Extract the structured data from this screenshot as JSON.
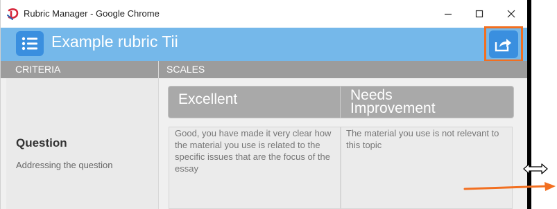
{
  "window": {
    "title": "Rubric Manager - Google Chrome",
    "controls": {
      "minimize": "—",
      "maximize": "☐",
      "close": "✕"
    }
  },
  "header": {
    "title": "Example rubric Tii",
    "menu_icon": "list-icon",
    "share_icon": "share-icon"
  },
  "columns": {
    "criteria": "CRITERIA",
    "scales": "SCALES"
  },
  "scales": [
    "Excellent",
    "Needs Improvement"
  ],
  "criterion": {
    "title": "Question",
    "description": "Addressing the question",
    "cells": [
      "Good, you have made it very clear how the material you use is related to the specific issues that are the focus of the essay",
      "The material you use is not relevant to this topic"
    ]
  },
  "colors": {
    "header_bg": "#75b8ea",
    "button_bg": "#3a8fdf",
    "highlight": "#f26f20",
    "column_header_bg": "#9c9c9c",
    "scale_bar_bg": "#a9a9a9"
  }
}
